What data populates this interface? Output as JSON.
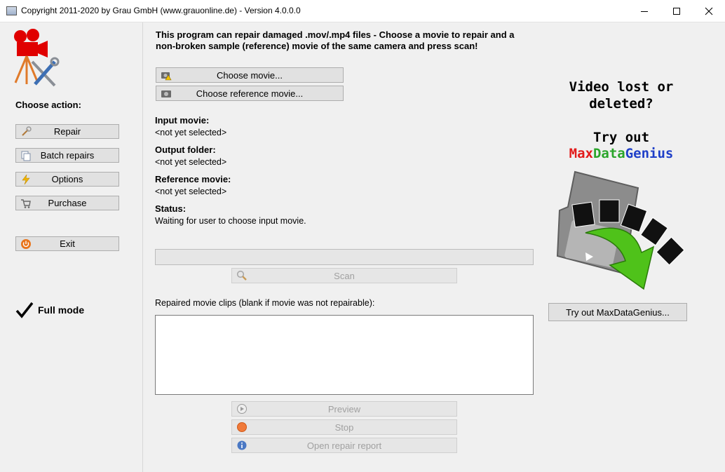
{
  "window": {
    "title": "Copyright 2011-2020 by Grau GmbH (www.grauonline.de) - Version 4.0.0.0"
  },
  "sidebar": {
    "choose_action": "Choose action:",
    "buttons": {
      "repair": "Repair",
      "batch": "Batch repairs",
      "options": "Options",
      "purchase": "Purchase",
      "exit": "Exit"
    },
    "full_mode": "Full mode"
  },
  "main": {
    "intro": "This program can repair damaged .mov/.mp4 files - Choose a movie to repair and a non-broken sample (reference) movie of the same camera and press scan!",
    "choose_movie": "Choose movie...",
    "choose_reference": "Choose reference movie...",
    "input_label": "Input movie:",
    "input_value": "<not yet selected>",
    "output_label": "Output folder:",
    "output_value": "<not yet selected>",
    "reference_label": "Reference movie:",
    "reference_value": "<not yet selected>",
    "status_label": "Status:",
    "status_value": "Waiting for user to choose input movie.",
    "progress_value": 0,
    "scan": "Scan",
    "clips_label": "Repaired movie clips (blank if movie was not repairable):",
    "preview": "Preview",
    "stop": "Stop",
    "open_report": "Open repair report"
  },
  "ad": {
    "line1": "Video lost or",
    "line2": "deleted?",
    "line3": "Try out",
    "brand": {
      "part1": "Max",
      "part2": "Data",
      "part3": "Genius"
    },
    "brand_colors": {
      "part1": "#e21b1b",
      "part2": "#2aa52a",
      "part3": "#1f3fc8"
    },
    "button": "Try out MaxDataGenius..."
  }
}
